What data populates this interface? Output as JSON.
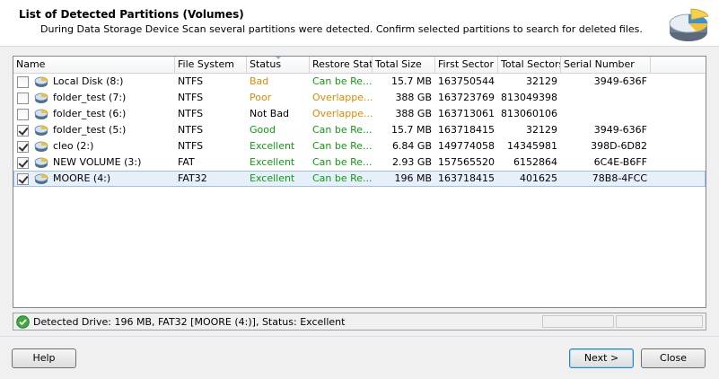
{
  "header": {
    "title": "List of Detected Partitions (Volumes)",
    "subtitle": "During Data Storage Device Scan several partitions were detected. Confirm selected partitions to search for deleted files."
  },
  "columns": [
    "Name",
    "File System",
    "Status",
    "Restore Statu",
    "Total Size",
    "First Sector",
    "Total Sectors",
    "Serial Number"
  ],
  "rows": [
    {
      "checked": false,
      "name": "Local Disk (8:)",
      "fs": "NTFS",
      "status": "Bad",
      "status_color": "#e08a00",
      "restore": "Can be Re...",
      "restore_color": "#129a12",
      "size": "15.7 MB",
      "first": "163750544",
      "total": "32129",
      "serial": "3949-636F"
    },
    {
      "checked": false,
      "name": "folder_test (7:)",
      "fs": "NTFS",
      "status": "Poor",
      "status_color": "#e08a00",
      "restore": "Overlappe...",
      "restore_color": "#e08a00",
      "size": "388 GB",
      "first": "163723769",
      "total": "813049398",
      "serial": ""
    },
    {
      "checked": false,
      "name": "folder_test (6:)",
      "fs": "NTFS",
      "status": "Not Bad",
      "status_color": "#000000",
      "restore": "Overlappe...",
      "restore_color": "#e08a00",
      "size": "388 GB",
      "first": "163713061",
      "total": "813060106",
      "serial": ""
    },
    {
      "checked": true,
      "name": "folder_test (5:)",
      "fs": "NTFS",
      "status": "Good",
      "status_color": "#129a12",
      "restore": "Can be Re...",
      "restore_color": "#129a12",
      "size": "15.7 MB",
      "first": "163718415",
      "total": "32129",
      "serial": "3949-636F"
    },
    {
      "checked": true,
      "name": "cleo (2:)",
      "fs": "NTFS",
      "status": "Excellent",
      "status_color": "#129a12",
      "restore": "Can be Re...",
      "restore_color": "#129a12",
      "size": "6.84 GB",
      "first": "149774058",
      "total": "14345981",
      "serial": "398D-6D82"
    },
    {
      "checked": true,
      "name": "NEW VOLUME (3:)",
      "fs": "FAT",
      "status": "Excellent",
      "status_color": "#129a12",
      "restore": "Can be Re...",
      "restore_color": "#129a12",
      "size": "2.93 GB",
      "first": "157565520",
      "total": "6152864",
      "serial": "6C4E-B6FF"
    },
    {
      "checked": true,
      "name": "MOORE (4:)",
      "fs": "FAT32",
      "status": "Excellent",
      "status_color": "#129a12",
      "restore": "Can be Re...",
      "restore_color": "#129a12",
      "size": "196 MB",
      "first": "163718415",
      "total": "401625",
      "serial": "78B8-4FCC",
      "selected": true
    }
  ],
  "status_bar": {
    "text": "Detected Drive: 196 MB, FAT32 [MOORE (4:)], Status: Excellent"
  },
  "buttons": {
    "help": "Help",
    "next": "Next >",
    "close": "Close"
  },
  "icons": {
    "header": "pie-chart-disk-icon",
    "row": "hard-disk-icon",
    "status": "check-circle-icon"
  }
}
